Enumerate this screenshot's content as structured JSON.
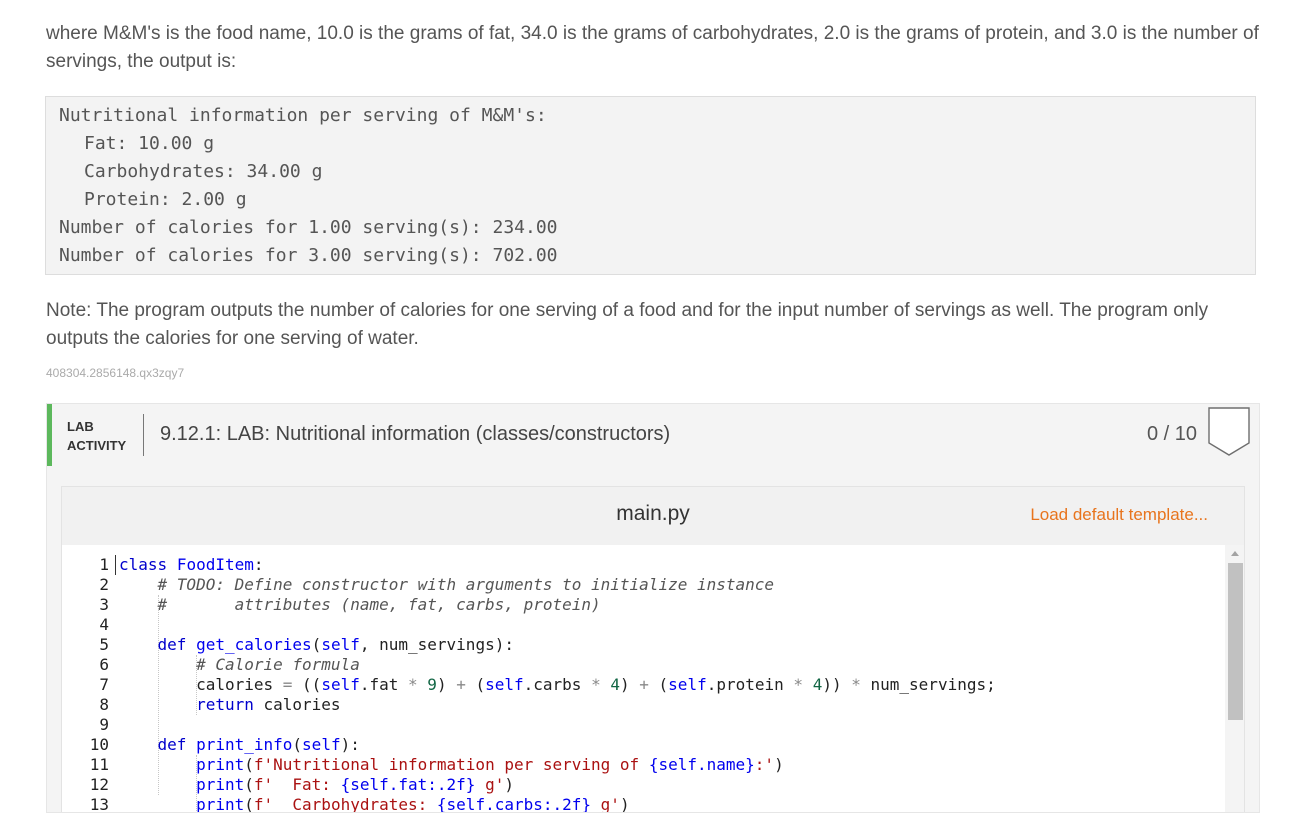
{
  "intro_text": "where M&M's is the food name, 10.0 is the grams of fat, 34.0 is the grams of carbohydrates, 2.0 is the grams of protein, and 3.0 is the number of servings, the output is:",
  "output_lines": [
    "Nutritional information per serving of M&M's:",
    "Fat: 10.00 g",
    "Carbohydrates: 34.00 g",
    "Protein: 2.00 g",
    "Number of calories for 1.00 serving(s): 234.00",
    "Number of calories for 3.00 serving(s): 702.00"
  ],
  "note_text": "Note: The program outputs the number of calories for one serving of a food and for the input number of servings as well. The program only outputs the calories for one serving of water.",
  "identifier": "408304.2856148.qx3zqy7",
  "lab": {
    "tag_line1": "LAB",
    "tag_line2": "ACTIVITY",
    "title": "9.12.1: LAB: Nutritional information (classes/constructors)",
    "score": "0 / 10",
    "accent_color": "#5cb85c"
  },
  "editor": {
    "file_name": "main.py",
    "load_label": "Load default template...",
    "line_numbers": [
      "1",
      "2",
      "3",
      "4",
      "5",
      "6",
      "7",
      "8",
      "9",
      "10",
      "11",
      "12",
      "13"
    ]
  }
}
